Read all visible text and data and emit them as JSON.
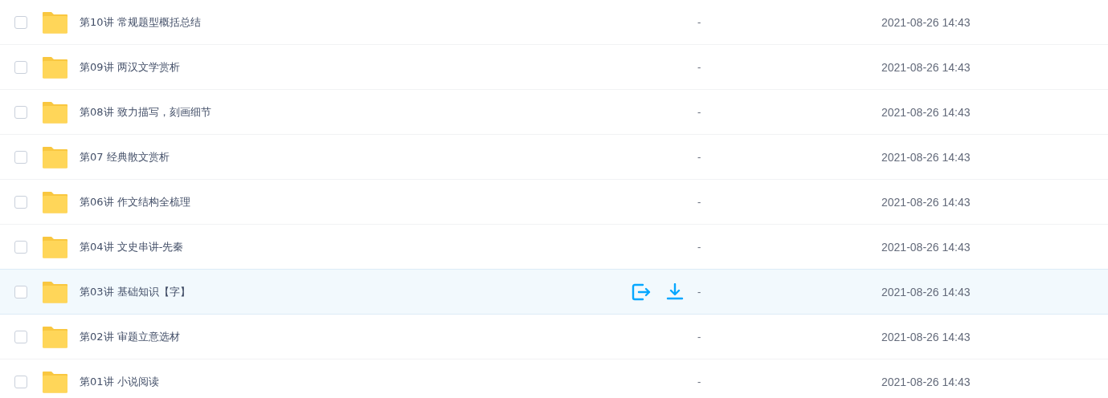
{
  "rows": [
    {
      "name": "第10讲 常规题型概括总结",
      "size": "-",
      "modified": "2021-08-26 14:43",
      "checked": false,
      "hovered": false
    },
    {
      "name": "第09讲 两汉文学赏析",
      "size": "-",
      "modified": "2021-08-26 14:43",
      "checked": false,
      "hovered": false
    },
    {
      "name": "第08讲 致力描写，刻画细节",
      "size": "-",
      "modified": "2021-08-26 14:43",
      "checked": false,
      "hovered": false
    },
    {
      "name": "第07 经典散文赏析",
      "size": "-",
      "modified": "2021-08-26 14:43",
      "checked": false,
      "hovered": false
    },
    {
      "name": "第06讲 作文结构全梳理",
      "size": "-",
      "modified": "2021-08-26 14:43",
      "checked": false,
      "hovered": false
    },
    {
      "name": "第04讲 文史串讲-先秦",
      "size": "-",
      "modified": "2021-08-26 14:43",
      "checked": false,
      "hovered": false
    },
    {
      "name": "第03讲 基础知识【字】",
      "size": "-",
      "modified": "2021-08-26 14:43",
      "checked": false,
      "hovered": true
    },
    {
      "name": "第02讲 审题立意选材",
      "size": "-",
      "modified": "2021-08-26 14:43",
      "checked": false,
      "hovered": false
    },
    {
      "name": "第01讲 小说阅读",
      "size": "-",
      "modified": "2021-08-26 14:43",
      "checked": false,
      "hovered": false
    }
  ]
}
